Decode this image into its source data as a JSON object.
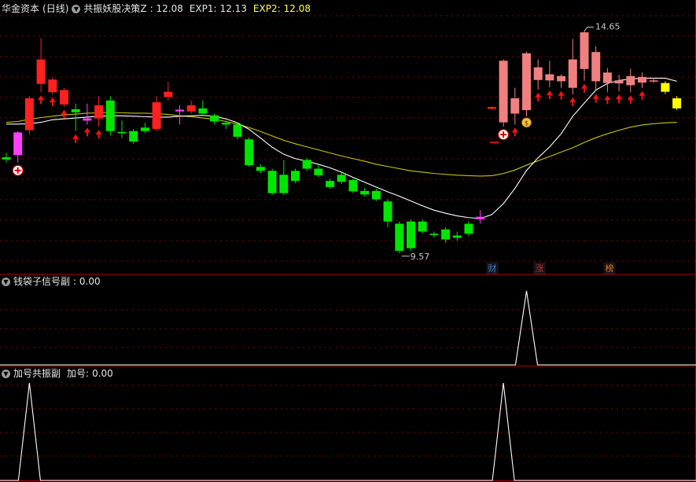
{
  "panel1": {
    "stock": "华金资本",
    "period": "(日线)",
    "indicator_name": "共振妖股决策Z",
    "indicator_value": ": 12.08",
    "exp1_label": "EXP1:",
    "exp1_value": "12.13",
    "exp2_label": "EXP2:",
    "exp2_value": "12.08",
    "high_label": "14.65",
    "low_label": "9.57",
    "tags": [
      {
        "text": "财",
        "color": "#3b82c4"
      },
      {
        "text": "涨",
        "color": "#c0392b"
      },
      {
        "text": "榜",
        "color": "#e67e22"
      }
    ]
  },
  "panel2": {
    "title": "钱袋子信号副",
    "value_text": ": 0.00"
  },
  "panel3": {
    "title": "加号共振副",
    "label": "加号:",
    "value_text": "0.00"
  },
  "colors": {
    "up": "#ff2020",
    "up_light": "#f08080",
    "down": "#00e600",
    "magenta": "#ff40ff",
    "yellow": "#ffff00",
    "exp1_line": "#ffffff",
    "exp2_line": "#c8c800",
    "grid": "#8b0000",
    "border": "#b00000"
  },
  "chart_data": {
    "type": "candlestick",
    "price_range": [
      9.35,
      15.0
    ],
    "candles": [
      {
        "o": 11.71,
        "c": 11.76,
        "h": 11.86,
        "l": 11.64,
        "color": "down"
      },
      {
        "o": 11.81,
        "c": 12.33,
        "h": 12.36,
        "l": 11.64,
        "color": "magenta",
        "mark": "plus"
      },
      {
        "o": 12.38,
        "c": 13.11,
        "h": 13.16,
        "l": 12.28,
        "color": "up"
      },
      {
        "o": 13.44,
        "c": 14.0,
        "h": 14.49,
        "l": 13.25,
        "color": "up",
        "arrow": true
      },
      {
        "o": 13.25,
        "c": 13.54,
        "h": 13.59,
        "l": 13.2,
        "color": "up",
        "arrow": true
      },
      {
        "o": 12.97,
        "c": 13.3,
        "h": 13.35,
        "l": 12.92,
        "color": "up",
        "arrow": true
      },
      {
        "o": 12.79,
        "c": 12.86,
        "h": 12.99,
        "l": 12.36,
        "color": "down",
        "arrow": true
      },
      {
        "o": 12.6,
        "c": 12.65,
        "h": 12.99,
        "l": 12.51,
        "color": "magenta",
        "arrow": true
      },
      {
        "o": 12.65,
        "c": 12.95,
        "h": 13.16,
        "l": 12.46,
        "color": "up",
        "arrow": true
      },
      {
        "o": 13.06,
        "c": 12.36,
        "h": 13.16,
        "l": 12.26,
        "color": "down"
      },
      {
        "o": 12.34,
        "c": 12.31,
        "h": 12.6,
        "l": 12.21,
        "color": "down"
      },
      {
        "o": 12.36,
        "c": 12.12,
        "h": 12.41,
        "l": 12.07,
        "color": "down"
      },
      {
        "o": 12.44,
        "c": 12.36,
        "h": 12.55,
        "l": 12.31,
        "color": "down"
      },
      {
        "o": 12.41,
        "c": 13.02,
        "h": 13.16,
        "l": 12.36,
        "color": "up"
      },
      {
        "o": 13.14,
        "c": 13.26,
        "h": 13.49,
        "l": 13.06,
        "color": "up"
      },
      {
        "o": 12.81,
        "c": 12.85,
        "h": 12.95,
        "l": 12.51,
        "color": "magenta"
      },
      {
        "o": 12.81,
        "c": 12.95,
        "h": 13.06,
        "l": 12.76,
        "color": "up"
      },
      {
        "o": 12.88,
        "c": 12.76,
        "h": 13.06,
        "l": 12.71,
        "color": "down"
      },
      {
        "o": 12.72,
        "c": 12.58,
        "h": 12.76,
        "l": 12.51,
        "color": "down"
      },
      {
        "o": 12.55,
        "c": 12.51,
        "h": 12.6,
        "l": 12.41,
        "color": "down"
      },
      {
        "o": 12.51,
        "c": 12.23,
        "h": 12.56,
        "l": 12.17,
        "color": "down"
      },
      {
        "o": 12.17,
        "c": 11.58,
        "h": 12.21,
        "l": 11.54,
        "color": "down"
      },
      {
        "o": 11.54,
        "c": 11.45,
        "h": 11.6,
        "l": 11.4,
        "color": "down"
      },
      {
        "o": 11.45,
        "c": 10.94,
        "h": 11.5,
        "l": 10.9,
        "color": "down"
      },
      {
        "o": 10.94,
        "c": 11.36,
        "h": 11.7,
        "l": 10.9,
        "color": "down"
      },
      {
        "o": 11.45,
        "c": 11.22,
        "h": 11.5,
        "l": 11.17,
        "color": "down"
      },
      {
        "o": 11.7,
        "c": 11.5,
        "h": 11.75,
        "l": 11.45,
        "color": "down"
      },
      {
        "o": 11.5,
        "c": 11.35,
        "h": 11.6,
        "l": 11.3,
        "color": "down"
      },
      {
        "o": 11.22,
        "c": 11.08,
        "h": 11.27,
        "l": 11.04,
        "color": "down"
      },
      {
        "o": 11.36,
        "c": 11.2,
        "h": 11.41,
        "l": 11.15,
        "color": "down"
      },
      {
        "o": 11.24,
        "c": 10.98,
        "h": 11.27,
        "l": 10.94,
        "color": "down"
      },
      {
        "o": 10.99,
        "c": 10.91,
        "h": 11.06,
        "l": 10.86,
        "color": "down"
      },
      {
        "o": 10.99,
        "c": 10.8,
        "h": 11.04,
        "l": 10.76,
        "color": "down"
      },
      {
        "o": 10.75,
        "c": 10.29,
        "h": 10.8,
        "l": 10.16,
        "color": "down"
      },
      {
        "o": 10.24,
        "c": 9.62,
        "h": 10.29,
        "l": 9.57,
        "color": "down"
      },
      {
        "o": 10.29,
        "c": 9.68,
        "h": 10.34,
        "l": 9.62,
        "color": "down"
      },
      {
        "o": 10.29,
        "c": 10.06,
        "h": 10.34,
        "l": 10.01,
        "color": "down"
      },
      {
        "o": 10.01,
        "c": 9.98,
        "h": 10.06,
        "l": 9.92,
        "color": "down"
      },
      {
        "o": 10.11,
        "c": 9.88,
        "h": 10.16,
        "l": 9.8,
        "color": "down"
      },
      {
        "o": 9.97,
        "c": 9.92,
        "h": 10.06,
        "l": 9.85,
        "color": "down"
      },
      {
        "o": 10.24,
        "c": 10.01,
        "h": 10.29,
        "l": 9.96,
        "color": "down"
      },
      {
        "o": 10.4,
        "c": 10.34,
        "h": 10.55,
        "l": 10.24,
        "color": "magenta"
      },
      {
        "o": 12.91,
        "c": 12.87,
        "h": 12.93,
        "l": 12.85,
        "color": "up"
      },
      {
        "o": 12.56,
        "c": 13.97,
        "h": 14.0,
        "l": 12.46,
        "color": "up_light",
        "mark": "plus"
      },
      {
        "o": 12.76,
        "c": 13.11,
        "h": 13.35,
        "l": 12.51,
        "color": "up_light",
        "arrow": true
      },
      {
        "o": 12.84,
        "c": 14.14,
        "h": 14.18,
        "l": 12.7,
        "color": "up_light",
        "mark": "money"
      },
      {
        "o": 13.53,
        "c": 13.82,
        "h": 14.0,
        "l": 13.31,
        "color": "up_light",
        "arrow": true
      },
      {
        "o": 13.52,
        "c": 13.66,
        "h": 13.97,
        "l": 13.36,
        "color": "up_light",
        "arrow": true
      },
      {
        "o": 13.5,
        "c": 13.62,
        "h": 13.66,
        "l": 13.35,
        "color": "up_light",
        "arrow": true
      },
      {
        "o": 13.35,
        "c": 14.0,
        "h": 14.47,
        "l": 13.2,
        "color": "up_light",
        "arrow": true
      },
      {
        "o": 13.78,
        "c": 14.62,
        "h": 14.65,
        "l": 13.51,
        "color": "up_light",
        "arrow": true
      },
      {
        "o": 13.5,
        "c": 14.17,
        "h": 14.3,
        "l": 13.28,
        "color": "up_light",
        "arrow": true
      },
      {
        "o": 13.46,
        "c": 13.7,
        "h": 13.8,
        "l": 13.25,
        "color": "up_light",
        "arrow": true
      },
      {
        "o": 13.45,
        "c": 13.52,
        "h": 13.65,
        "l": 13.27,
        "color": "up_light",
        "arrow": true
      },
      {
        "o": 13.41,
        "c": 13.62,
        "h": 13.79,
        "l": 13.25,
        "color": "up_light",
        "arrow": true
      },
      {
        "o": 13.47,
        "c": 13.6,
        "h": 13.7,
        "l": 13.35,
        "color": "up_light",
        "arrow": true
      },
      {
        "o": 13.52,
        "c": 13.5,
        "h": 13.58,
        "l": 13.46,
        "color": "up_light"
      },
      {
        "o": 13.46,
        "c": 13.26,
        "h": 13.5,
        "l": 13.21,
        "color": "yellow"
      },
      {
        "o": 13.11,
        "c": 12.88,
        "h": 13.16,
        "l": 12.84,
        "color": "yellow"
      }
    ],
    "exp1": [
      12.52,
      12.52,
      12.53,
      12.56,
      12.62,
      12.64,
      12.66,
      12.68,
      12.7,
      12.71,
      12.71,
      12.7,
      12.69,
      12.68,
      12.68,
      12.7,
      12.71,
      12.72,
      12.7,
      12.64,
      12.55,
      12.4,
      12.2,
      11.99,
      11.83,
      11.73,
      11.67,
      11.6,
      11.52,
      11.42,
      11.3,
      11.19,
      11.08,
      10.97,
      10.87,
      10.76,
      10.65,
      10.55,
      10.48,
      10.42,
      10.38,
      10.36,
      10.45,
      10.7,
      11.05,
      11.46,
      11.75,
      12.0,
      12.3,
      12.7,
      13.0,
      13.3,
      13.45,
      13.52,
      13.55,
      13.57,
      13.57,
      13.57,
      13.5
    ],
    "exp2": [
      12.56,
      12.58,
      12.63,
      12.67,
      12.7,
      12.73,
      12.75,
      12.77,
      12.78,
      12.78,
      12.78,
      12.77,
      12.77,
      12.76,
      12.74,
      12.71,
      12.69,
      12.66,
      12.63,
      12.58,
      12.52,
      12.44,
      12.35,
      12.25,
      12.15,
      12.07,
      12.0,
      11.93,
      11.86,
      11.79,
      11.73,
      11.67,
      11.6,
      11.55,
      11.5,
      11.45,
      11.42,
      11.39,
      11.37,
      11.35,
      11.34,
      11.33,
      11.34,
      11.39,
      11.47,
      11.58,
      11.68,
      11.78,
      11.88,
      11.98,
      12.1,
      12.21,
      12.3,
      12.38,
      12.45,
      12.5,
      12.53,
      12.55,
      12.56
    ],
    "qiandai": [
      0,
      0,
      0,
      0,
      0,
      0,
      0,
      0,
      0,
      0,
      0,
      0,
      0,
      0,
      0,
      0,
      0,
      0,
      0,
      0,
      0,
      0,
      0,
      0,
      0,
      0,
      0,
      0,
      0,
      0,
      0,
      0,
      0,
      0,
      0,
      0,
      0,
      0,
      0,
      0,
      0,
      0,
      0,
      0,
      0,
      1,
      0,
      0,
      0,
      0,
      0,
      0,
      0,
      0,
      0,
      0,
      0,
      0,
      0
    ],
    "jiahao": [
      0,
      0,
      1,
      0,
      0,
      0,
      0,
      0,
      0,
      0,
      0,
      0,
      0,
      0,
      0,
      0,
      0,
      0,
      0,
      0,
      0,
      0,
      0,
      0,
      0,
      0,
      0,
      0,
      0,
      0,
      0,
      0,
      0,
      0,
      0,
      0,
      0,
      0,
      0,
      0,
      0,
      0,
      0,
      1,
      0,
      0,
      0,
      0,
      0,
      0,
      0,
      0,
      0,
      0,
      0,
      0,
      0,
      0,
      0
    ]
  }
}
